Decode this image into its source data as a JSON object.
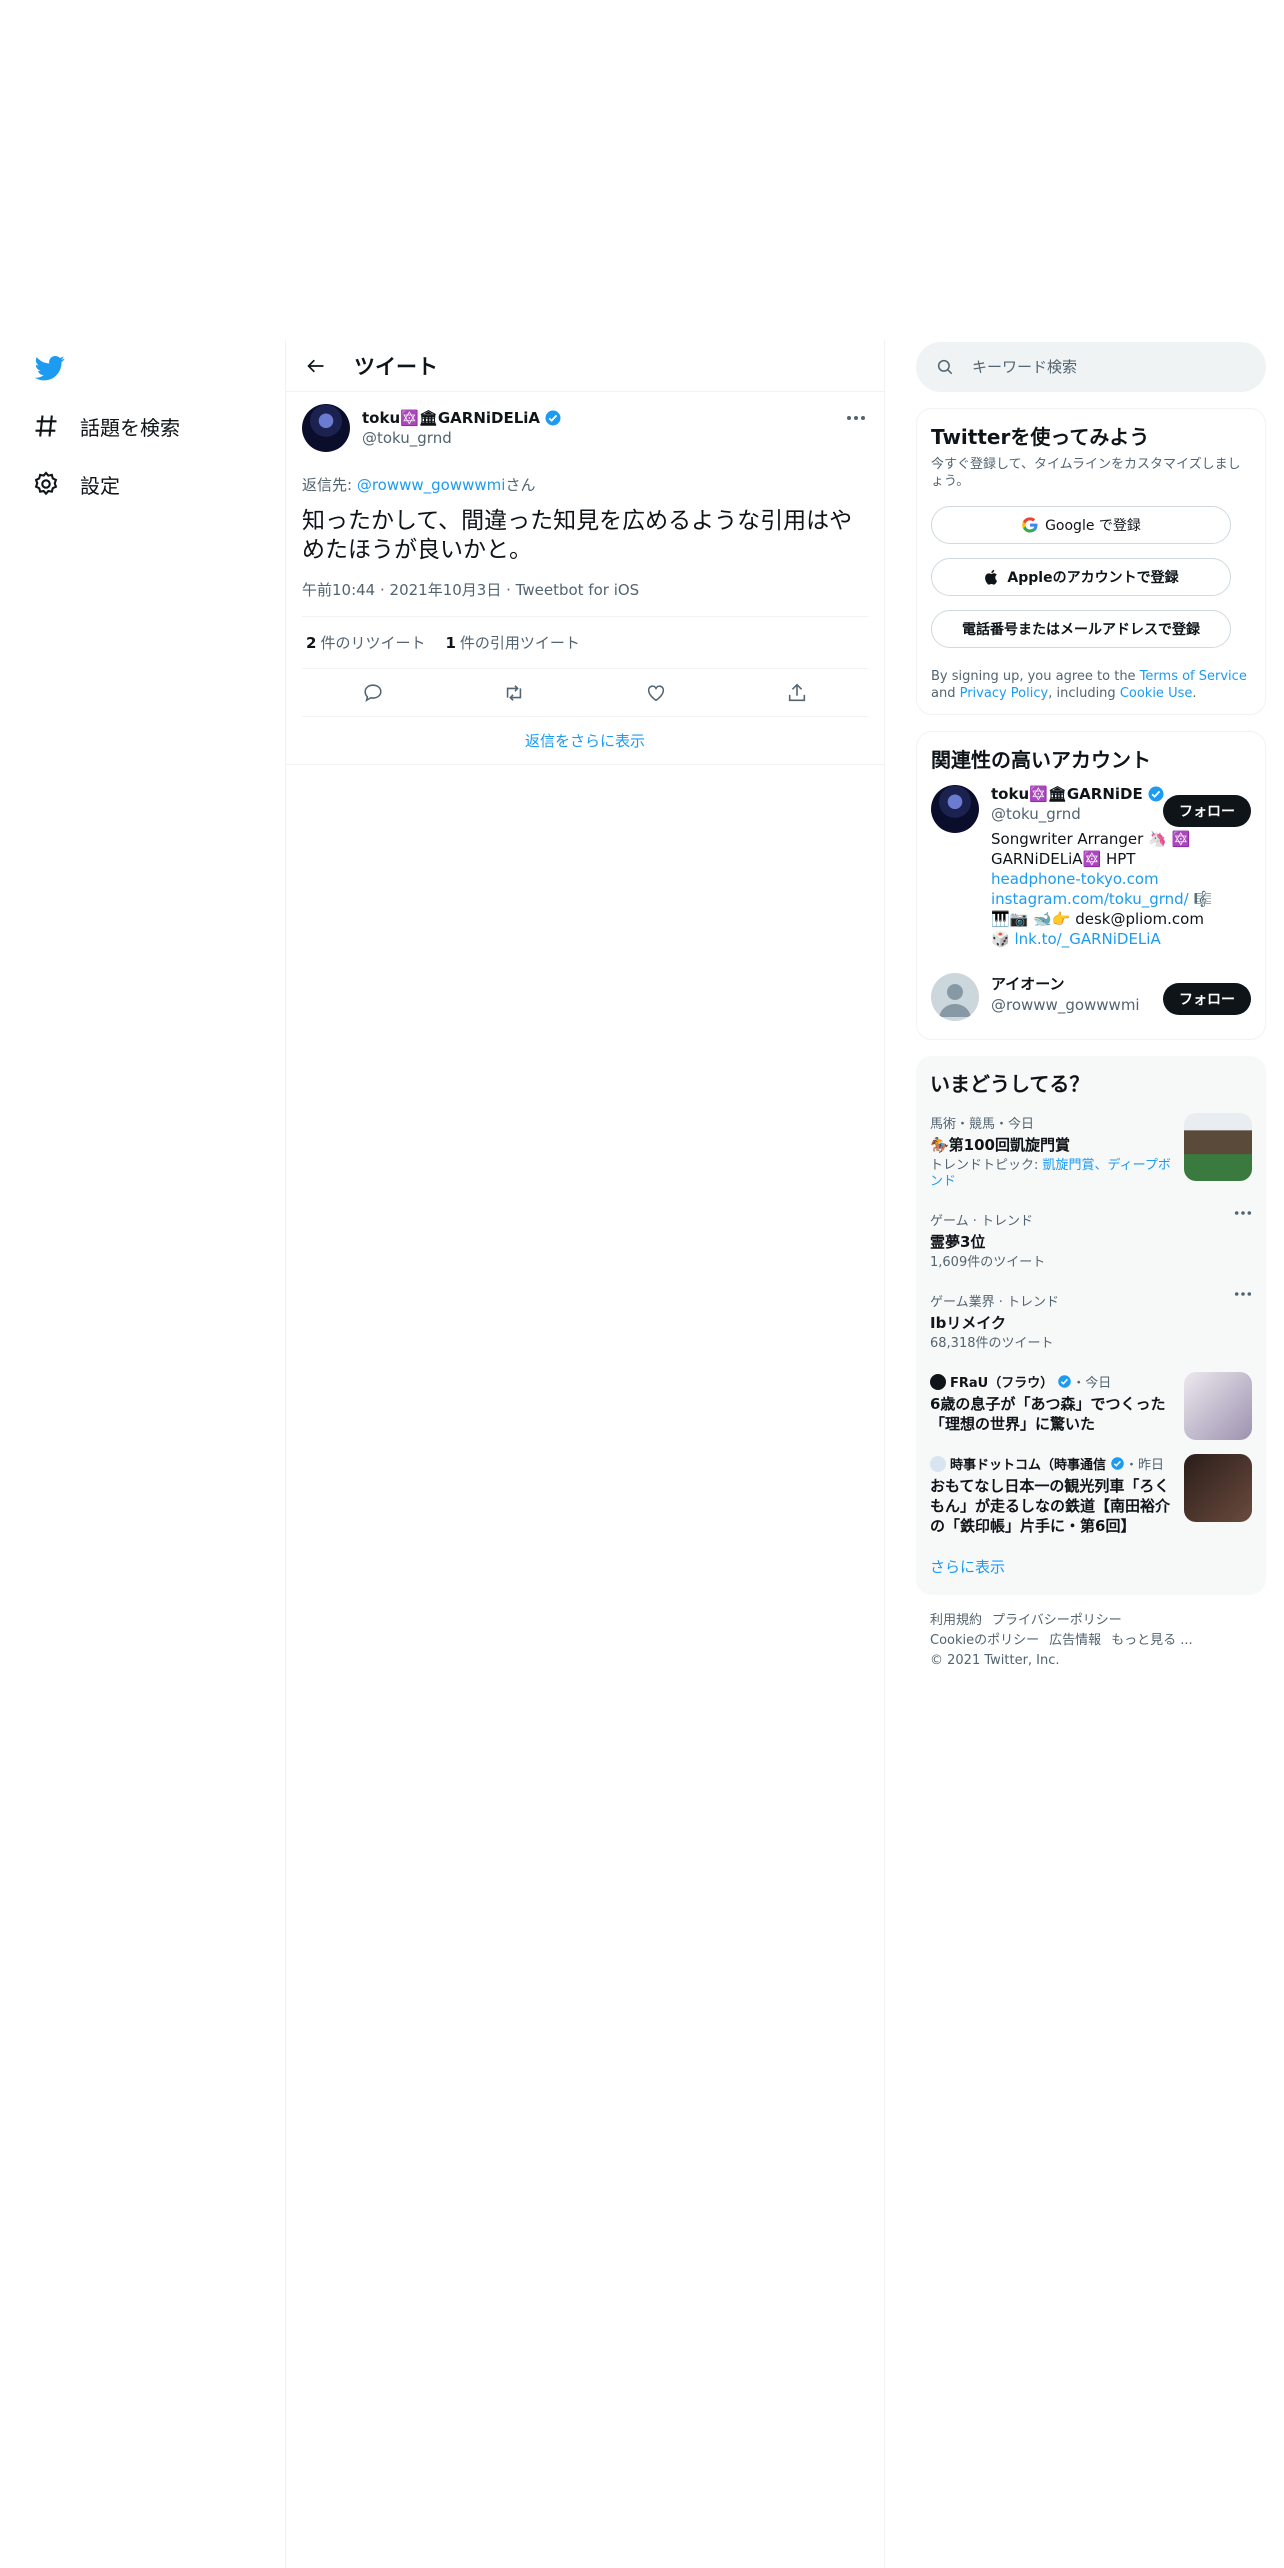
{
  "nav": {
    "explore_label": "話題を検索",
    "settings_label": "設定"
  },
  "header": {
    "title": "ツイート"
  },
  "tweet": {
    "display_name": "toku🔯🏛GARNiDELiA",
    "handle": "@toku_grnd",
    "reply_prefix": "返信先: ",
    "reply_handle": "@rowww_gowwwmi",
    "reply_suffix": "さん",
    "text": "知ったかして、間違った知見を広めるような引用はやめたほうが良いかと。",
    "time": "午前10:44",
    "date": "2021年10月3日",
    "client": "Tweetbot for iOS",
    "retweet_count": "2",
    "retweet_label": "件のリツイート",
    "quote_count": "1",
    "quote_label": "件の引用ツイート",
    "more_replies": "返信をさらに表示"
  },
  "search": {
    "placeholder": "キーワード検索"
  },
  "signup": {
    "title": "Twitterを使ってみよう",
    "subtitle": "今すぐ登録して、タイムラインをカスタマイズしましょう。",
    "google_label": "Google で登録",
    "apple_label": "Appleのアカウントで登録",
    "phone_label": "電話番号またはメールアドレスで登録",
    "fine_1": "By signing up, you agree to the ",
    "terms_label": "Terms of Service",
    "fine_2": " and ",
    "privacy_label": "Privacy Policy",
    "fine_3": ", including ",
    "cookie_label": "Cookie Use",
    "fine_4": "."
  },
  "related": {
    "title": "関連性の高いアカウント",
    "accounts": [
      {
        "name": "toku🔯🏛GARNiDE",
        "handle": "@toku_grnd",
        "follow_label": "フォロー",
        "bio_1": "Songwriter Arranger 🦄 🔯 GARNiDELiA🔯 HPT ",
        "bio_link_1": "headphone-tokyo.com",
        "bio_2": " ",
        "bio_link_2": "instagram.com/toku_grnd/",
        "bio_3": " 🎼🎹📷 🐋👉 desk@pliom.com 🎲 ",
        "bio_link_3": "lnk.to/_GARNiDELiA"
      },
      {
        "name": "アイオーン",
        "handle": "@rowww_gowwwmi",
        "follow_label": "フォロー"
      }
    ]
  },
  "trends": {
    "title": "いまどうしてる？",
    "items": [
      {
        "context": "馬術・競馬・今日",
        "title": "🏇第100回凱旋門賞",
        "topic_prefix": "トレンドトピック: ",
        "topic_links": "凱旋門賞、ディープボンド"
      },
      {
        "context": "ゲーム · トレンド",
        "title": "霊夢3位",
        "count": "1,609件のツイート"
      },
      {
        "context": "ゲーム業界 · トレンド",
        "title": "Ibリメイク",
        "count": "68,318件のツイート"
      },
      {
        "publisher": "FRaU（フラウ）",
        "when": "・今日",
        "title": "6歳の息子が「あつ森」でつくった「理想の世界」に驚いた"
      },
      {
        "publisher": "時事ドットコム（時事通信",
        "when": "・昨日",
        "title": "おもてなし日本一の観光列車「ろくもん」が走るしなの鉄道【南田裕介の「鉄印帳」片手に・第6回】"
      }
    ],
    "show_more": "さらに表示"
  },
  "footer": {
    "terms": "利用規約",
    "privacy": "プライバシーポリシー",
    "cookie": "Cookieのポリシー",
    "ads": "広告情報",
    "more": "もっと見る ...",
    "copyright": "© 2021 Twitter, Inc."
  },
  "colors": {
    "accent": "#1d9bf0",
    "text": "#0f1419",
    "muted": "#536471",
    "border": "#eff3f4"
  }
}
